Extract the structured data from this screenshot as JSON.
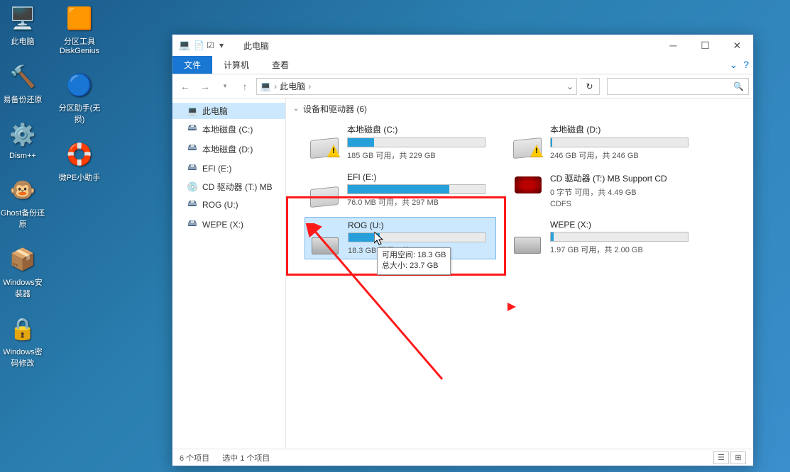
{
  "desktop": {
    "col1": [
      {
        "label": "此电脑",
        "glyph": "🖥️"
      },
      {
        "label": "易备份还原",
        "glyph": "🔨"
      },
      {
        "label": "Dism++",
        "glyph": "⚙️"
      },
      {
        "label": "Ghost备份还原",
        "glyph": "🐵"
      },
      {
        "label": "Windows安装器",
        "glyph": "📦"
      },
      {
        "label": "Windows密码修改",
        "glyph": "🔒"
      }
    ],
    "col2": [
      {
        "label": "分区工具DiskGenius",
        "glyph": "🟧"
      },
      {
        "label": "分区助手(无损)",
        "glyph": "🔵"
      },
      {
        "label": "微PE小助手",
        "glyph": "🛟"
      }
    ]
  },
  "window": {
    "title": "此电脑",
    "tabs": {
      "file": "文件",
      "computer": "计算机",
      "view": "查看"
    },
    "breadcrumb": {
      "root": "此电脑"
    },
    "sidebar": [
      {
        "label": "此电脑",
        "icon": "💻",
        "selected": true
      },
      {
        "label": "本地磁盘 (C:)",
        "icon": "🖴"
      },
      {
        "label": "本地磁盘 (D:)",
        "icon": "🖴"
      },
      {
        "label": "EFI (E:)",
        "icon": "🖴"
      },
      {
        "label": "CD 驱动器 (T:) MB",
        "icon": "💿"
      },
      {
        "label": "ROG (U:)",
        "icon": "🖴"
      },
      {
        "label": "WEPE (X:)",
        "icon": "🖴"
      }
    ],
    "section": {
      "header": "设备和驱动器 (6)"
    },
    "drives": [
      {
        "name": "本地磁盘 (C:)",
        "stats": "185 GB 可用，共 229 GB",
        "fill": 19,
        "warn": true,
        "type": "hdd"
      },
      {
        "name": "本地磁盘 (D:)",
        "stats": "246 GB 可用，共 246 GB",
        "fill": 1,
        "warn": true,
        "type": "hdd"
      },
      {
        "name": "EFI (E:)",
        "stats": "76.0 MB 可用，共 297 MB",
        "fill": 74,
        "warn": false,
        "type": "hdd"
      },
      {
        "name": "CD 驱动器 (T:) MB Support CD",
        "stats": "0 字节 可用，共 4.49 GB",
        "sub": "CDFS",
        "type": "rog"
      },
      {
        "name": "ROG (U:)",
        "stats": "18.3 GB 可用，共 23.7 GB",
        "fill": 23,
        "warn": false,
        "type": "usb",
        "selected": true
      },
      {
        "name": "WEPE (X:)",
        "stats": "1.97 GB 可用，共 2.00 GB",
        "fill": 2,
        "warn": false,
        "type": "usb"
      }
    ],
    "tooltip": {
      "line1": "可用空间: 18.3 GB",
      "line2": "总大小: 23.7 GB"
    },
    "status": {
      "count": "6 个项目",
      "selected": "选中 1 个项目"
    }
  }
}
